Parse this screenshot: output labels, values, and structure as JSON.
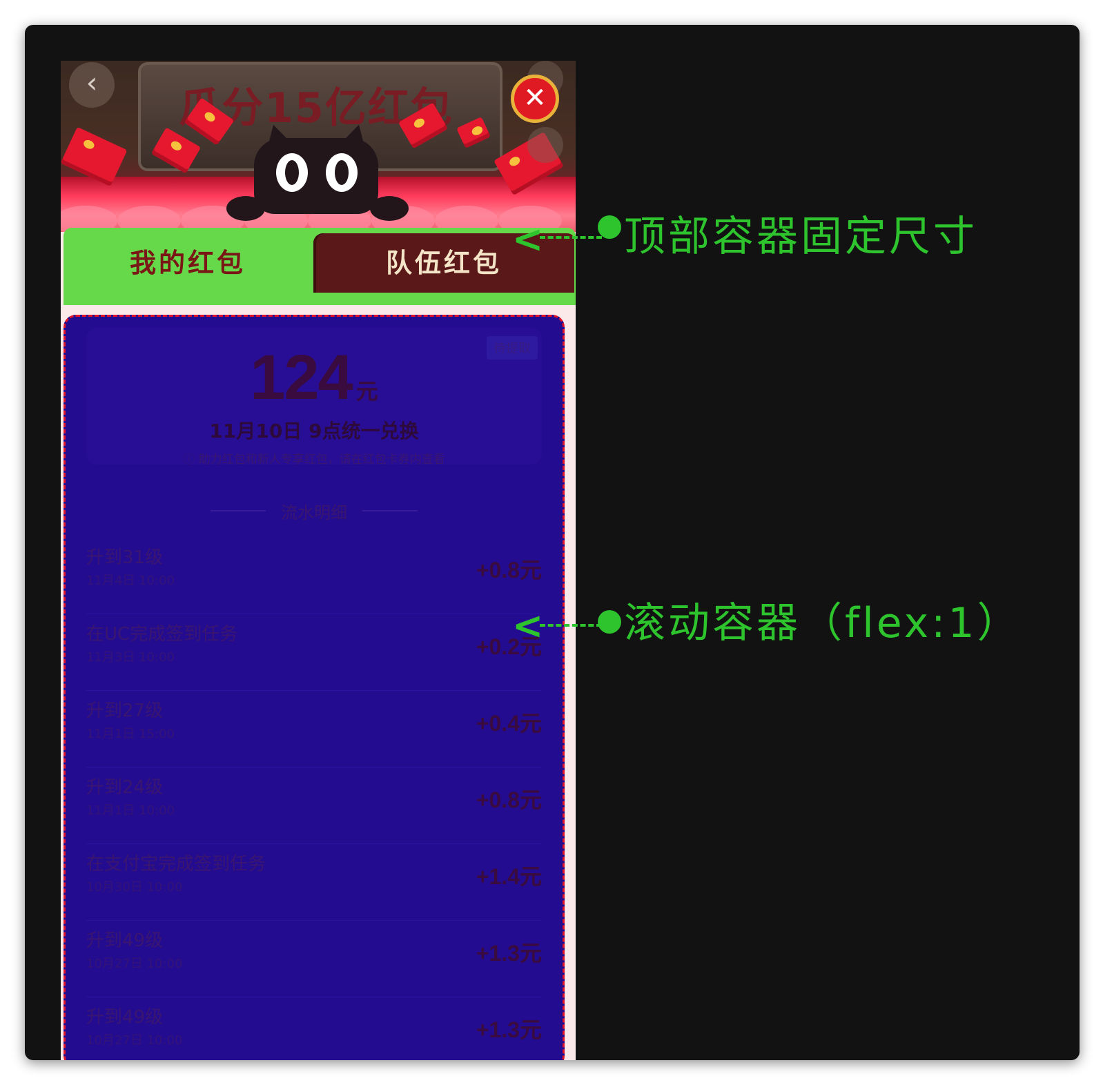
{
  "header": {
    "banner_title": "瓜分15亿红包",
    "close_glyph": "✕",
    "back_glyph": "‹"
  },
  "tabs": [
    {
      "label": "我的红包",
      "active": true
    },
    {
      "label": "队伍红包",
      "active": false
    }
  ],
  "summary": {
    "badge": "待提取",
    "amount": "124",
    "unit": "元",
    "exchange": "11月10日 9点统一兑换",
    "note": "ⓘ 助力红包和新人专享红包，请在红包卡券内查看"
  },
  "flow": {
    "header": "流水明细",
    "records": [
      {
        "title": "升到31级",
        "time": "11月4日 10:00",
        "amount": "+0.8元"
      },
      {
        "title": "在UC完成签到任务",
        "time": "11月3日 10:00",
        "amount": "+0.2元"
      },
      {
        "title": "升到27级",
        "time": "11月1日 15:00",
        "amount": "+0.4元"
      },
      {
        "title": "升到24级",
        "time": "11月1日 10:00",
        "amount": "+0.8元"
      },
      {
        "title": "在支付宝完成签到任务",
        "time": "10月30日 10:00",
        "amount": "+1.4元"
      },
      {
        "title": "升到49级",
        "time": "10月27日 10:00",
        "amount": "+1.3元"
      },
      {
        "title": "升到49级",
        "time": "10月27日 10:00",
        "amount": "+1.3元"
      }
    ]
  },
  "annotations": {
    "top_label": "顶部容器固定尺寸",
    "scroll_label": "滚动容器（flex:1）",
    "color": "#2ec42e"
  },
  "colors": {
    "scroll_bg": "#240c90",
    "tab_active": "#66d94a",
    "tab_inactive": "#5a1818",
    "dashed_border": "#e0142a"
  }
}
